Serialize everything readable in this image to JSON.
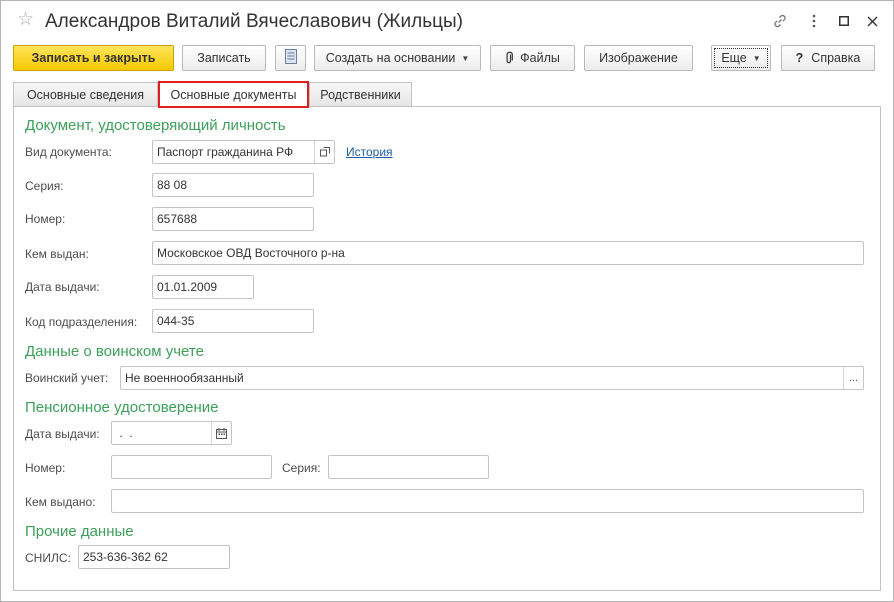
{
  "window": {
    "title": "Александров Виталий Вячеславович (Жильцы)"
  },
  "toolbar": {
    "save_close": "Записать и закрыть",
    "save": "Записать",
    "create_based_on": "Создать на основании",
    "files": "Файлы",
    "image": "Изображение",
    "more": "Еще",
    "help_q": "?",
    "help": "Справка"
  },
  "tabs": [
    {
      "label": "Основные сведения"
    },
    {
      "label": "Основные документы"
    },
    {
      "label": "Родственники"
    }
  ],
  "identity": {
    "section": "Документ, удостоверяющий личность",
    "doc_type_label": "Вид документа:",
    "doc_type_value": "Паспорт гражданина РФ",
    "history_link": "История",
    "series_label": "Серия:",
    "series_value": "88 08",
    "number_label": "Номер:",
    "number_value": "657688",
    "issued_by_label": "Кем выдан:",
    "issued_by_value": "Московское ОВД Восточного р-на",
    "issue_date_label": "Дата выдачи:",
    "issue_date_value": "01.01.2009",
    "division_code_label": "Код подразделения:",
    "division_code_value": "044-35"
  },
  "military": {
    "section": "Данные о воинском учете",
    "label": "Воинский учет:",
    "value": "Не военнообязанный",
    "select_btn": "..."
  },
  "pension": {
    "section": "Пенсионное удостоверение",
    "issue_date_label": "Дата выдачи:",
    "issue_date_value": " .  .",
    "number_label": "Номер:",
    "number_value": "",
    "series_label": "Серия:",
    "series_value": "",
    "issued_by_label": "Кем выдано:",
    "issued_by_value": ""
  },
  "other": {
    "section": "Прочие данные",
    "snils_label": "СНИЛС:",
    "snils_value": "253-636-362 62"
  }
}
